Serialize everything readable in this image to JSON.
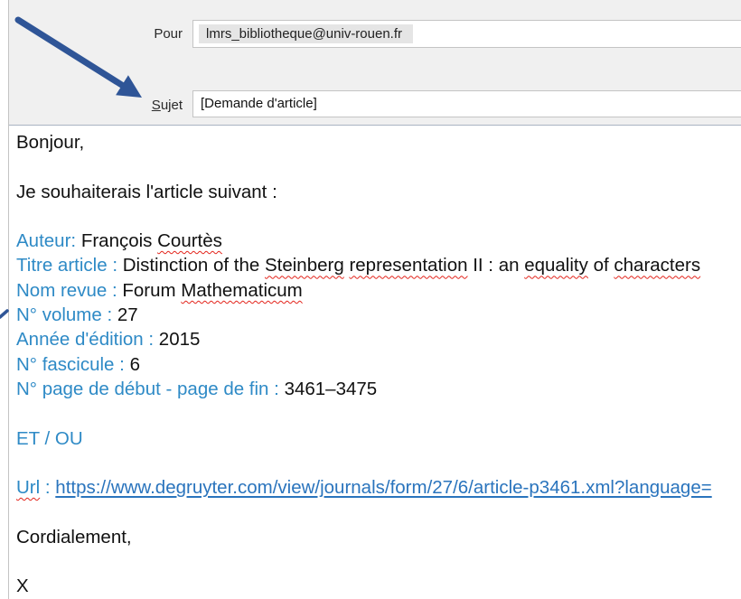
{
  "compose": {
    "to_button_label": "Pour",
    "to_recipient": "lmrs_bibliotheque@univ-rouen.fr",
    "subject_label": "Sujet",
    "subject_value": "[Demande d'article]"
  },
  "message": {
    "greeting": "Bonjour,",
    "intro": "Je souhaiterais l'article suivant :",
    "fields": [
      {
        "label": "Auteur:",
        "value_parts": [
          "François",
          "Courtès"
        ]
      },
      {
        "label": "Titre article :",
        "value_parts": [
          "Distinction of the",
          "Steinberg",
          "representation",
          "II : an",
          "equality",
          "of",
          "characters"
        ]
      },
      {
        "label": "Nom revue :",
        "value_parts": [
          "Forum",
          "Mathematicum"
        ]
      },
      {
        "label": "N° volume :",
        "value_parts": [
          "27"
        ]
      },
      {
        "label": "Année d'édition :",
        "value_parts": [
          "2015"
        ]
      },
      {
        "label": "N° fascicule :",
        "value_parts": [
          "6"
        ]
      },
      {
        "label": "N° page de début - page de fin :",
        "value_parts": [
          "3461–3475"
        ]
      }
    ],
    "alternative": "ET / OU",
    "url_label": "Url",
    "url_separator": ":",
    "url": "https://www.degruyter.com/view/journals/form/27/6/article-p3461.xml?language=",
    "closing": "Cordialement,",
    "signature": "X"
  },
  "colors": {
    "header_bg": "#f0f0f0",
    "field_label_blue": "#2e8ac6",
    "link_blue": "#2a74bd",
    "annotation_arrow": "#2f5597",
    "spellcheck_red": "#e3241b"
  }
}
